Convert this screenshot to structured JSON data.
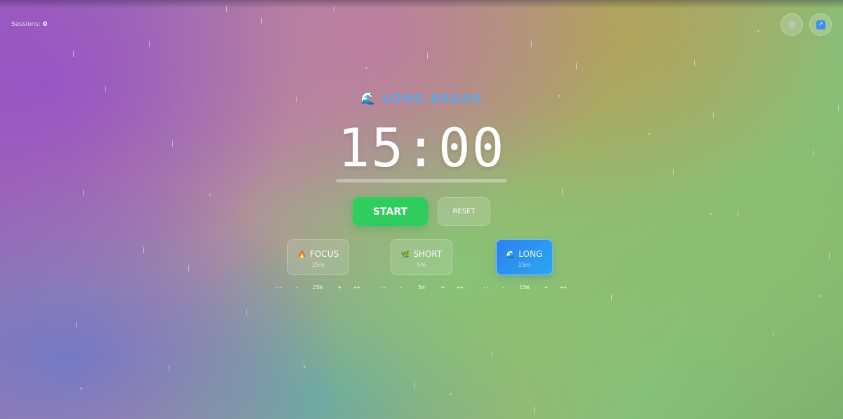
{
  "header": {
    "sessions_label": "Sessions:",
    "sessions_count": "0"
  },
  "top_buttons": {
    "settings_icon": "gear-icon",
    "fullscreen_icon": "fullscreen-icon"
  },
  "timer": {
    "mode_label": "LONG BREAK",
    "mode_icon": "wave-icon",
    "display": "15:00",
    "progress": 0
  },
  "controls": {
    "start_label": "START",
    "reset_label": "RESET"
  },
  "modes": [
    {
      "label": "FOCUS",
      "minutes": "25m",
      "icon": "fire-icon",
      "active": false
    },
    {
      "label": "SHORT",
      "minutes": "5m",
      "icon": "leaf-icon",
      "active": false
    },
    {
      "label": "LONG",
      "minutes": "15m",
      "icon": "wave-icon",
      "active": true
    }
  ],
  "adjusters": [
    {
      "dec_big": "--",
      "dec": "-",
      "value": "25m",
      "inc": "+",
      "inc_big": "++"
    },
    {
      "dec_big": "--",
      "dec": "-",
      "value": "5m",
      "inc": "+",
      "inc_big": "++"
    },
    {
      "dec_big": "--",
      "dec": "-",
      "value": "15m",
      "inc": "+",
      "inc_big": "++"
    }
  ],
  "colors": {
    "accent_start": "#2fcc5e",
    "accent_long": "#2e7ff0",
    "mode_title": "#5ea6ec"
  }
}
